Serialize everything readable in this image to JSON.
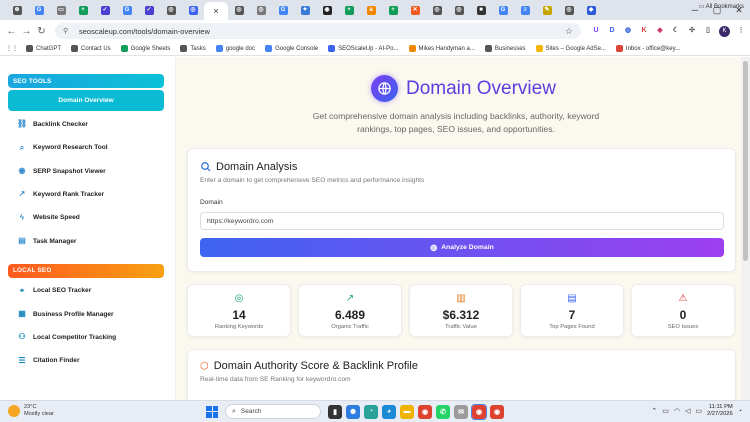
{
  "browser": {
    "tabs": [
      {
        "icon": "chatgpt-icon",
        "glyph": "⊛",
        "color": "#555"
      },
      {
        "icon": "google-icon",
        "glyph": "G",
        "color": "#4285f4"
      },
      {
        "icon": "page-icon",
        "glyph": "▭",
        "color": "#777"
      },
      {
        "icon": "sheets-icon",
        "glyph": "+",
        "color": "#0f9d58"
      },
      {
        "icon": "checkmark-icon",
        "glyph": "✓",
        "color": "#4b3fd1"
      },
      {
        "icon": "google-icon",
        "glyph": "G",
        "color": "#4285f4"
      },
      {
        "icon": "checkmark-icon",
        "glyph": "✓",
        "color": "#4b3fd1"
      },
      {
        "icon": "site-icon",
        "glyph": "◎",
        "color": "#555"
      },
      {
        "icon": "tool-icon",
        "glyph": "◎",
        "color": "#3c63f0"
      },
      {
        "icon": "active-tab-icon",
        "glyph": "×",
        "color": "#333",
        "active": true
      },
      {
        "icon": "site-icon",
        "glyph": "◎",
        "color": "#555"
      },
      {
        "icon": "site-icon",
        "glyph": "◎",
        "color": "#777"
      },
      {
        "icon": "google-icon",
        "glyph": "G",
        "color": "#4285f4"
      },
      {
        "icon": "gemini-icon",
        "glyph": "✦",
        "color": "#3a7bd5"
      },
      {
        "icon": "github-icon",
        "glyph": "◉",
        "color": "#222"
      },
      {
        "icon": "sheets-icon",
        "glyph": "+",
        "color": "#0f9d58"
      },
      {
        "icon": "amazon-icon",
        "glyph": "a",
        "color": "#f08804"
      },
      {
        "icon": "sheets-icon",
        "glyph": "+",
        "color": "#0f9d58"
      },
      {
        "icon": "orange-icon",
        "glyph": "✕",
        "color": "#f05a22"
      },
      {
        "icon": "site-icon",
        "glyph": "◎",
        "color": "#555"
      },
      {
        "icon": "site-icon",
        "glyph": "◎",
        "color": "#555"
      },
      {
        "icon": "dark-icon",
        "glyph": "■",
        "color": "#333"
      },
      {
        "icon": "google-icon",
        "glyph": "G",
        "color": "#4285f4"
      },
      {
        "icon": "docs-icon",
        "glyph": "≡",
        "color": "#4285f4"
      },
      {
        "icon": "pen-icon",
        "glyph": "✎",
        "color": "#c8a400"
      },
      {
        "icon": "site-icon",
        "glyph": "◎",
        "color": "#555"
      },
      {
        "icon": "shield-icon",
        "glyph": "◆",
        "color": "#2a5bd7"
      }
    ],
    "url": "seoscaleup.com/tools/domain-overview",
    "profile_initial": "K",
    "bookmarks": [
      {
        "label": "ChatGPT",
        "color": "#555"
      },
      {
        "label": "Contact Us",
        "color": "#555"
      },
      {
        "label": "Google Sheets",
        "color": "#0f9d58"
      },
      {
        "label": "Tasks",
        "color": "#555"
      },
      {
        "label": "google doc",
        "color": "#4285f4"
      },
      {
        "label": "Google Console",
        "color": "#4285f4"
      },
      {
        "label": "SEOScaleUp - AI-Po...",
        "color": "#3c63f0"
      },
      {
        "label": "Mikes Handyman a...",
        "color": "#f08804"
      },
      {
        "label": "Businesses",
        "color": "#555"
      },
      {
        "label": "Sites – Google AdSe...",
        "color": "#f4b400"
      },
      {
        "label": "Inbox - office@key...",
        "color": "#db4437"
      }
    ],
    "all_bookmarks": "All Bookmarks"
  },
  "sidebar": {
    "seo_heading": "SEO TOOLS",
    "seo_items": [
      {
        "label": "Domain Overview",
        "icon": "globe-icon",
        "glyph": "◍",
        "active": true
      },
      {
        "label": "Backlink Checker",
        "icon": "link-icon",
        "glyph": "⛓"
      },
      {
        "label": "Keyword Research Tool",
        "icon": "search-icon",
        "glyph": "⌕"
      },
      {
        "label": "SERP Snapshot Viewer",
        "icon": "eye-icon",
        "glyph": "◉"
      },
      {
        "label": "Keyword Rank Tracker",
        "icon": "trend-icon",
        "glyph": "↗"
      },
      {
        "label": "Website Speed",
        "icon": "bolt-icon",
        "glyph": "ϟ"
      },
      {
        "label": "Task Manager",
        "icon": "document-icon",
        "glyph": "▤"
      }
    ],
    "local_heading": "LOCAL SEO",
    "local_items": [
      {
        "label": "Local SEO Tracker",
        "icon": "map-pin-icon",
        "glyph": "⌖"
      },
      {
        "label": "Business Profile Manager",
        "icon": "building-icon",
        "glyph": "▦"
      },
      {
        "label": "Local Competitor Tracking",
        "icon": "users-icon",
        "glyph": "⚇"
      },
      {
        "label": "Citation Finder",
        "icon": "list-icon",
        "glyph": "☰"
      }
    ]
  },
  "hero": {
    "title": "Domain Overview",
    "subtitle": "Get comprehensive domain analysis including backlinks, authority, keyword rankings, top pages, SEO issues, and opportunities."
  },
  "analysis": {
    "title": "Domain Analysis",
    "description": "Enter a domain to get comprehensive SEO metrics and performance insights",
    "field_label": "Domain",
    "value": "https://keywordro.com",
    "button": "Analyze Domain"
  },
  "stats": [
    {
      "value": "14",
      "label": "Ranking Keywords",
      "icon": "target-icon",
      "glyph": "◎"
    },
    {
      "value": "6.489",
      "label": "Organic Traffic",
      "icon": "trending-up-icon",
      "glyph": "↗"
    },
    {
      "value": "$6.312",
      "label": "Traffic Value",
      "icon": "bar-chart-icon",
      "glyph": "▥"
    },
    {
      "value": "7",
      "label": "Top Pages Found",
      "icon": "file-icon",
      "glyph": "▤"
    },
    {
      "value": "0",
      "label": "SEO Issues",
      "icon": "warning-icon",
      "glyph": "⚠"
    }
  ],
  "authority": {
    "title": "Domain Authority Score & Backlink Profile",
    "subtitle": "Real-time data from SE Ranking for keywordro.com"
  },
  "taskbar": {
    "temp": "23°C",
    "weather": "Mostly clear",
    "search": "Search",
    "time": "11:11 PM",
    "date": "2/27/2026"
  },
  "colors": {
    "accent_start": "#3e64f2",
    "accent_end": "#9d3ff0",
    "seo_header": "#0bc0d6",
    "local_header": "#ff5a1f",
    "stat_icon": "#19a36b"
  }
}
